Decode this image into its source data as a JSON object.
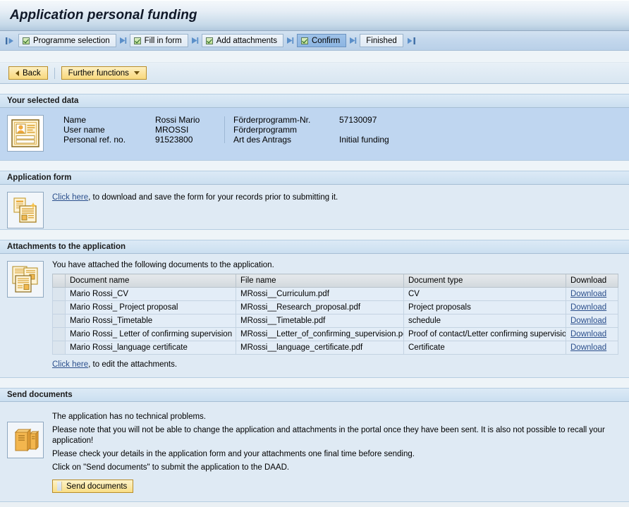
{
  "window": {
    "title": "Application personal funding"
  },
  "roadmap": {
    "start_icon": "roadmap-start-icon",
    "end_icon": "roadmap-end-icon",
    "steps": [
      {
        "label": "Programme selection",
        "checked": true,
        "current": false
      },
      {
        "label": "Fill in form",
        "checked": true,
        "current": false
      },
      {
        "label": "Add attachments",
        "checked": true,
        "current": false
      },
      {
        "label": "Confirm",
        "checked": true,
        "current": true
      },
      {
        "label": "Finished",
        "checked": false,
        "current": false
      }
    ]
  },
  "toolbar": {
    "back_label": "Back",
    "further_functions_label": "Further functions"
  },
  "selected_data": {
    "section_title": "Your selected data",
    "icon": "id-card-icon",
    "left_fields": [
      {
        "label": "Name",
        "value": "Rossi Mario"
      },
      {
        "label": "User name",
        "value": "MROSSI"
      },
      {
        "label": "Personal ref. no.",
        "value": "91523800"
      }
    ],
    "right_fields": [
      {
        "label": "Förderprogramm-Nr.",
        "value": "57130097"
      },
      {
        "label": "Förderprogramm",
        "value": ""
      },
      {
        "label": "Art des Antrags",
        "value": "Initial funding"
      }
    ]
  },
  "application_form": {
    "section_title": "Application form",
    "icon": "form-document-icon",
    "link_text": "Click here",
    "text_after_link": ", to download and save the form for your records prior to submitting it."
  },
  "attachments": {
    "section_title": "Attachments to the application",
    "icon": "documents-stack-icon",
    "intro": "You have attached the following documents to the application.",
    "columns": [
      "Document name",
      "File name",
      "Document type",
      "Download"
    ],
    "rows": [
      {
        "document_name": "Mario Rossi_CV",
        "file_name": "MRossi__Curriculum.pdf",
        "document_type": "CV",
        "download_label": "Download"
      },
      {
        "document_name": "Mario Rossi_ Project proposal",
        "file_name": "MRossi__Research_proposal.pdf",
        "document_type": "Project proposals",
        "download_label": "Download"
      },
      {
        "document_name": "Mario Rossi_Timetable",
        "file_name": "MRossi__Timetable.pdf",
        "document_type": "schedule",
        "download_label": "Download"
      },
      {
        "document_name": "Mario Rossi_ Letter of confirming supervision",
        "file_name": "MRossi__Letter_of_confirming_supervision.pdf",
        "document_type": "Proof of contact/Letter confirming supervision",
        "download_label": "Download"
      },
      {
        "document_name": "Mario Rossi_language certificate",
        "file_name": "MRossi__language_certificate.pdf",
        "document_type": "Certificate",
        "download_label": "Download"
      }
    ],
    "edit_link_text": "Click here",
    "edit_text_after_link": ", to edit the attachments."
  },
  "send_documents": {
    "section_title": "Send documents",
    "icon": "server-cabinets-icon",
    "lines": [
      "The application has no technical problems.",
      "Please note that you will not be able to change the application and attachments in the portal once they have been sent. It is also not possible to recall your application!",
      "Please check your details in the application form and your attachments one final time before sending.",
      "Click on \"Send documents\" to submit the application to the DAAD."
    ],
    "button_label": "Send documents"
  },
  "colors": {
    "title_bar_top": "#f4f8fb",
    "title_bar_bottom": "#b2c9de",
    "roadmap_bg": "#c3d7ec",
    "step_current_bg": "#8cb5e2",
    "section_header_bg": "#cbdff0",
    "section_body_bg": "#dfeaf4",
    "selected_data_body_bg": "#bfd6f0",
    "button_yellow": "#fbe29a",
    "link_blue": "#2b4f8c",
    "table_row_bg": "#e3edf7",
    "table_header_bg": "#d2d8dd"
  }
}
